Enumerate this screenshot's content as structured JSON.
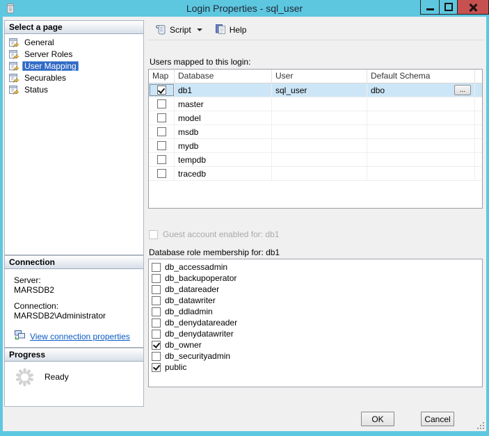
{
  "window": {
    "title": "Login Properties - sql_user"
  },
  "colors": {
    "titlebar": "#5ec7e0",
    "close_button": "#c75050",
    "selection": "#316ac5",
    "selected_row": "#cde6f7",
    "link": "#0a5bc4"
  },
  "sidebar": {
    "select_page": {
      "header": "Select a page",
      "items": [
        {
          "label": "General",
          "selected": false
        },
        {
          "label": "Server Roles",
          "selected": false
        },
        {
          "label": "User Mapping",
          "selected": true
        },
        {
          "label": "Securables",
          "selected": false
        },
        {
          "label": "Status",
          "selected": false
        }
      ]
    },
    "connection": {
      "header": "Connection",
      "server_label": "Server:",
      "server_value": "MARSDB2",
      "connection_label": "Connection:",
      "connection_value": "MARSDB2\\Administrator",
      "link_label": "View connection properties"
    },
    "progress": {
      "header": "Progress",
      "status": "Ready"
    }
  },
  "toolbar": {
    "script_label": "Script",
    "help_label": "Help"
  },
  "main": {
    "users_table": {
      "label": "Users mapped to this login:",
      "columns": [
        "Map",
        "Database",
        "User",
        "Default Schema"
      ],
      "browse_label": "...",
      "rows": [
        {
          "map": true,
          "database": "db1",
          "user": "sql_user",
          "default_schema": "dbo",
          "selected": true
        },
        {
          "map": false,
          "database": "master",
          "user": "",
          "default_schema": "",
          "selected": false
        },
        {
          "map": false,
          "database": "model",
          "user": "",
          "default_schema": "",
          "selected": false
        },
        {
          "map": false,
          "database": "msdb",
          "user": "",
          "default_schema": "",
          "selected": false
        },
        {
          "map": false,
          "database": "mydb",
          "user": "",
          "default_schema": "",
          "selected": false
        },
        {
          "map": false,
          "database": "tempdb",
          "user": "",
          "default_schema": "",
          "selected": false
        },
        {
          "map": false,
          "database": "tracedb",
          "user": "",
          "default_schema": "",
          "selected": false
        }
      ]
    },
    "guest": {
      "label": "Guest account enabled for: db1",
      "checked": false,
      "enabled": false
    },
    "roles": {
      "label": "Database role membership for: db1",
      "items": [
        {
          "label": "db_accessadmin",
          "checked": false
        },
        {
          "label": "db_backupoperator",
          "checked": false
        },
        {
          "label": "db_datareader",
          "checked": false
        },
        {
          "label": "db_datawriter",
          "checked": false
        },
        {
          "label": "db_ddladmin",
          "checked": false
        },
        {
          "label": "db_denydatareader",
          "checked": false
        },
        {
          "label": "db_denydatawriter",
          "checked": false
        },
        {
          "label": "db_owner",
          "checked": true
        },
        {
          "label": "db_securityadmin",
          "checked": false
        },
        {
          "label": "public",
          "checked": true
        }
      ]
    },
    "buttons": {
      "ok": "OK",
      "cancel": "Cancel"
    }
  }
}
